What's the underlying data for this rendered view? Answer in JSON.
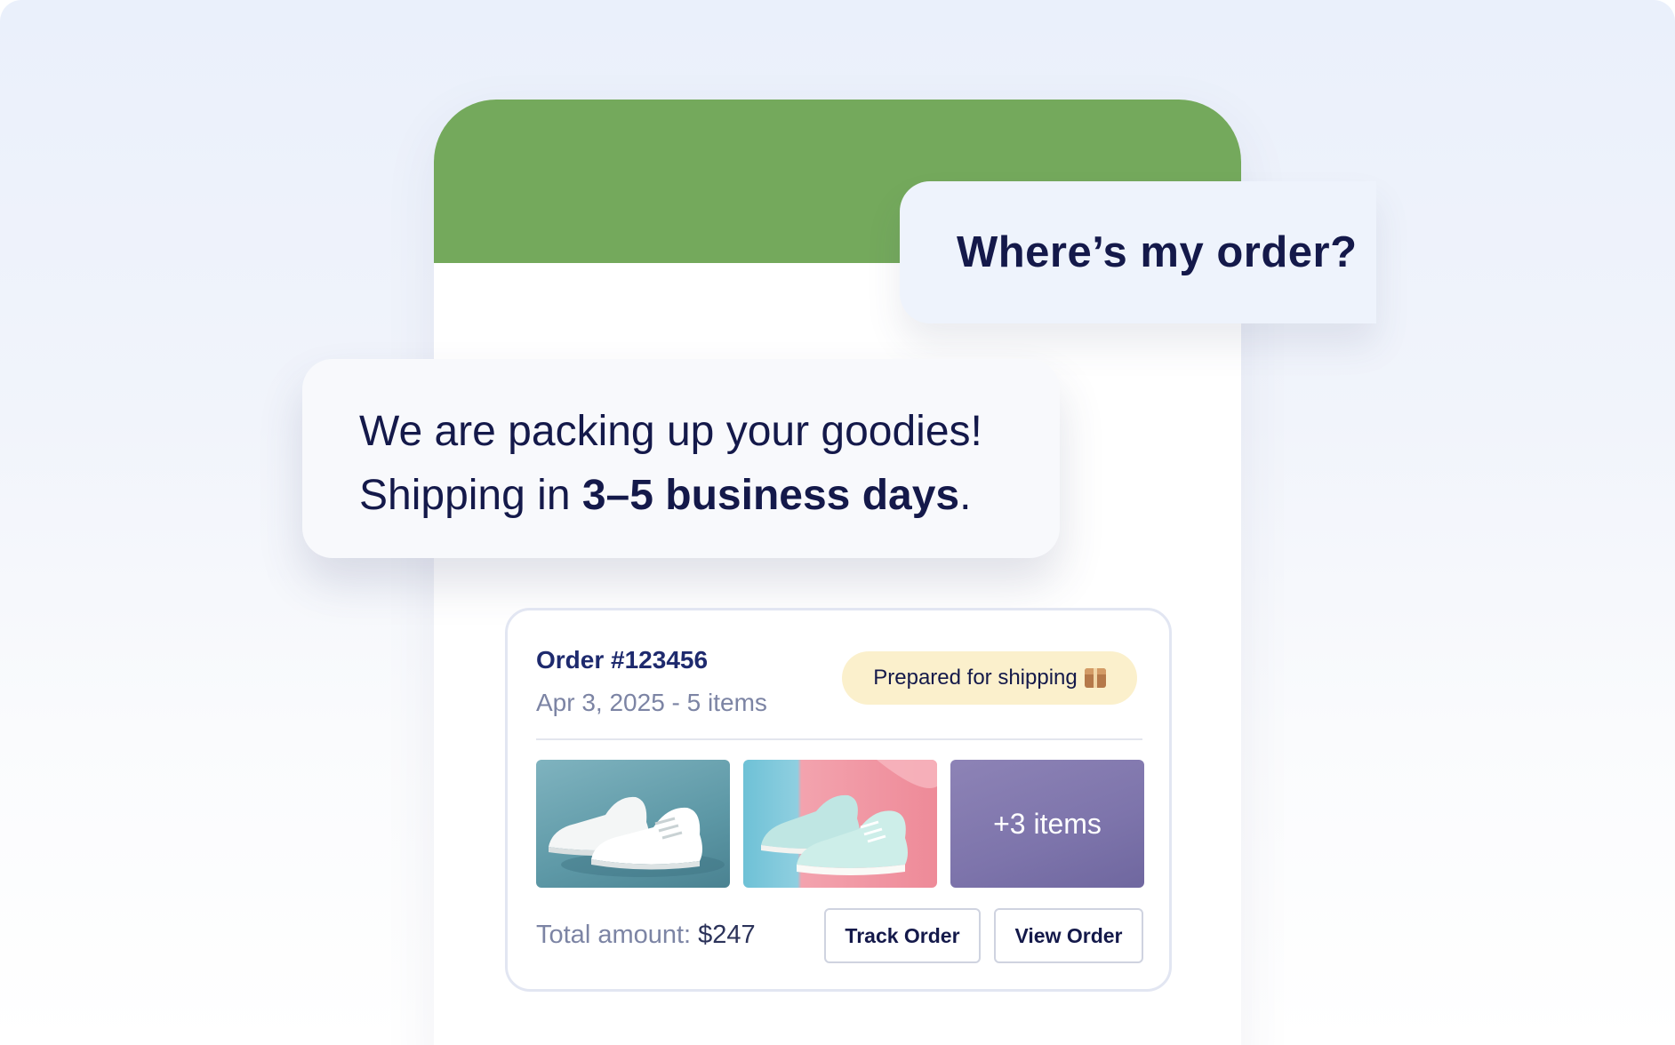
{
  "chat": {
    "user_message": "Where’s my order?",
    "bot_message_line1": "We are packing up your goodies!",
    "bot_message_line2_prefix": "Shipping in ",
    "bot_message_line2_bold": "3–5 business days",
    "bot_message_line2_suffix": "."
  },
  "order": {
    "title": "Order #123456",
    "meta": "Apr 3, 2025 - 5 items",
    "status": "Prepared for shipping",
    "status_icon": "package-icon",
    "more_items_label": "+3 items",
    "total_label": "Total amount: ",
    "total_value": "$247",
    "track_button": "Track Order",
    "view_button": "View Order"
  },
  "colors": {
    "header_green": "#74a95c",
    "text_navy": "#14194a",
    "badge_yellow": "#fbf0cc"
  }
}
